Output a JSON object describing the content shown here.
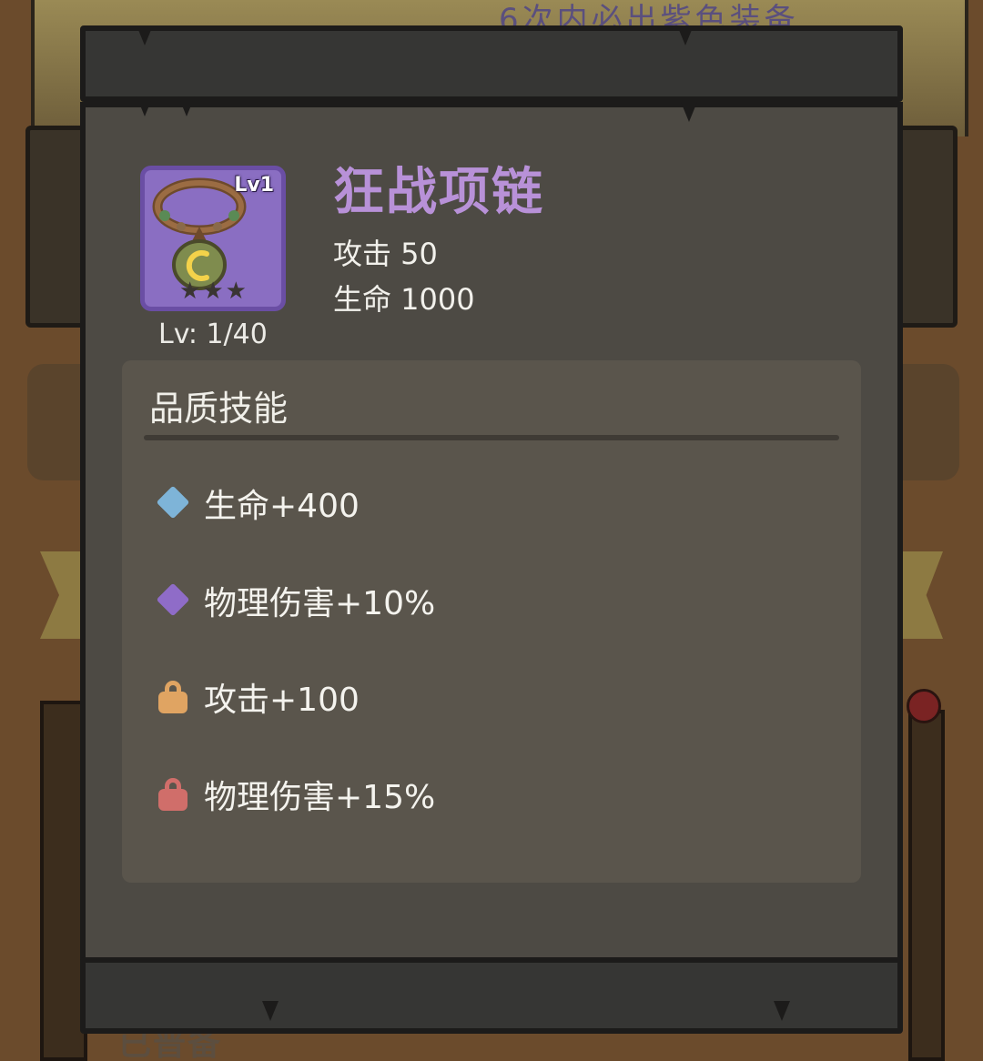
{
  "background": {
    "banner_text": "6次内必出紫色装备",
    "bottom_text": "已普备"
  },
  "item": {
    "name": "狂战项链",
    "icon": "necklace-icon",
    "level_badge": "Lv1",
    "stars": 3,
    "level_text": "Lv: 1/40",
    "stats": [
      {
        "label": "攻击 50"
      },
      {
        "label": "生命 1000"
      }
    ]
  },
  "skills": {
    "title": "品质技能",
    "items": [
      {
        "text": "生命+400",
        "icon": "blue-diamond-icon",
        "color": "#7eb4d8"
      },
      {
        "text": "物理伤害+10%",
        "icon": "purple-diamond-icon",
        "color": "#8f6cc8"
      },
      {
        "text": "攻击+100",
        "icon": "orange-lock-icon",
        "color": "#e0a462"
      },
      {
        "text": "物理伤害+15%",
        "icon": "red-lock-icon",
        "color": "#d06e6a"
      }
    ]
  },
  "colors": {
    "item_name": "#b891d8",
    "icon_bg": "#8a6ec2",
    "panel_bg": "#5a554c",
    "board_bg": "#4d4a44"
  }
}
